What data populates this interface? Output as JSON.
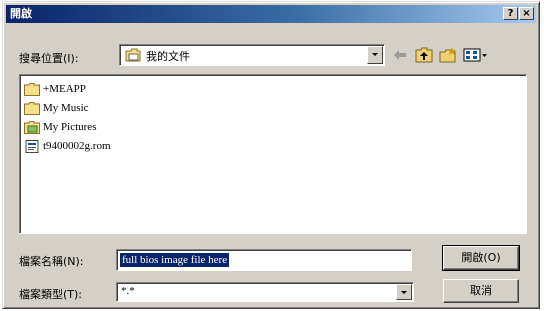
{
  "window": {
    "title": "開啟",
    "help_button": "?",
    "close_button": "×"
  },
  "lookin": {
    "label": "搜尋位置(I):",
    "value": "我的文件"
  },
  "toolbar": {
    "back_icon": "back-arrow-icon",
    "up_icon": "up-folder-icon",
    "new_folder_icon": "new-folder-icon",
    "views_icon": "view-menu-icon"
  },
  "files": [
    {
      "name": "+MEAPP",
      "icon": "folder-icon"
    },
    {
      "name": "My Music",
      "icon": "folder-icon"
    },
    {
      "name": "My Pictures",
      "icon": "pictures-folder-icon"
    },
    {
      "name": "t9400002g.rom",
      "icon": "file-icon"
    }
  ],
  "filename": {
    "label": "檔案名稱(N):",
    "value": "full bios image file here"
  },
  "filetype": {
    "label": "檔案類型(T):",
    "value": "*.*"
  },
  "buttons": {
    "open": "開啟(O)",
    "cancel": "取消"
  }
}
